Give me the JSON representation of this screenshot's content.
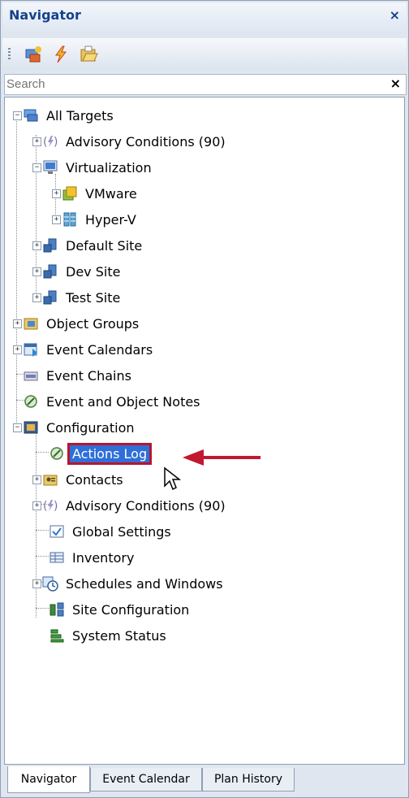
{
  "panel": {
    "title": "Navigator",
    "close_glyph": "×"
  },
  "toolbar": {
    "buttons": [
      {
        "name": "targets-icon"
      },
      {
        "name": "lightning-icon"
      },
      {
        "name": "folder-open-icon"
      }
    ]
  },
  "search": {
    "placeholder": "Search",
    "clear_glyph": "×"
  },
  "tree": {
    "items": [
      {
        "label": "All Targets"
      },
      {
        "label": "Advisory Conditions (90)"
      },
      {
        "label": "Virtualization"
      },
      {
        "label": "VMware"
      },
      {
        "label": "Hyper-V"
      },
      {
        "label": "Default Site"
      },
      {
        "label": "Dev Site"
      },
      {
        "label": "Test Site"
      },
      {
        "label": "Object Groups"
      },
      {
        "label": "Event Calendars"
      },
      {
        "label": "Event Chains"
      },
      {
        "label": "Event and Object Notes"
      },
      {
        "label": "Configuration"
      },
      {
        "label": "Actions Log"
      },
      {
        "label": "Contacts"
      },
      {
        "label": "Advisory Conditions (90)"
      },
      {
        "label": "Global Settings"
      },
      {
        "label": "Inventory"
      },
      {
        "label": "Schedules and Windows"
      },
      {
        "label": "Site Configuration"
      },
      {
        "label": "System Status"
      }
    ]
  },
  "tabs": [
    {
      "label": "Navigator"
    },
    {
      "label": "Event Calendar"
    },
    {
      "label": "Plan History"
    }
  ],
  "colors": {
    "selected_bg": "#2f6fd8",
    "highlight_border": "#b5172c",
    "title_text": "#15428b"
  }
}
